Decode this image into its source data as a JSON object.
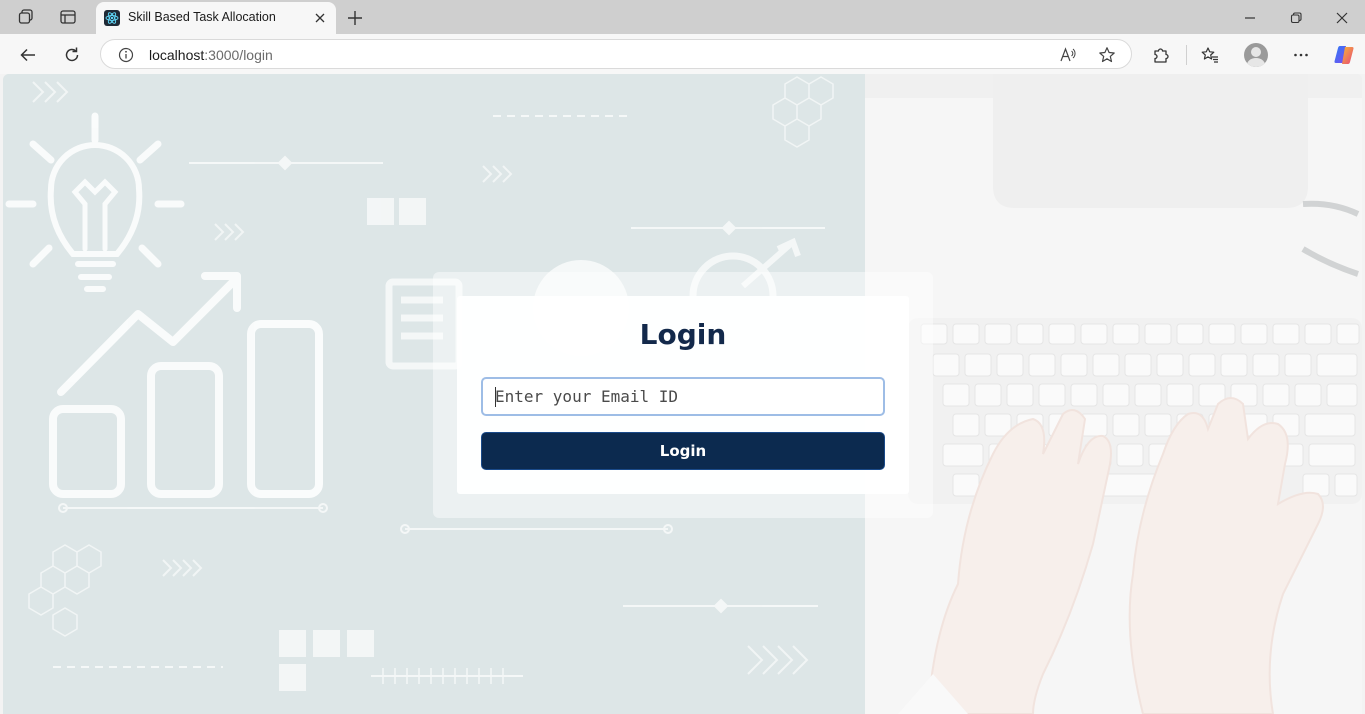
{
  "browser": {
    "tab_title": "Skill Based Task Allocation",
    "url_host": "localhost",
    "url_path": ":3000/login"
  },
  "icons": {
    "workspaces": "workspaces-icon",
    "tab_actions": "tab-actions-icon",
    "favicon": "react-icon",
    "close": "close-icon",
    "new_tab": "plus-icon",
    "minimize": "minimize-icon",
    "restore": "restore-icon",
    "window_close": "close-icon",
    "back": "back-arrow-icon",
    "refresh": "refresh-icon",
    "info": "info-icon",
    "read_aloud": "read-aloud-icon",
    "favorite": "star-icon",
    "extensions": "puzzle-icon",
    "favorites": "favorites-icon",
    "profile": "avatar-icon",
    "more": "more-icon",
    "copilot": "copilot-icon"
  },
  "login": {
    "title": "Login",
    "email_placeholder": "Enter your Email ID",
    "email_value": "",
    "button_label": "Login"
  },
  "colors": {
    "primary": "#0c2a4f",
    "title": "#13294b",
    "input_focus_border": "#9ebde6",
    "left_panel_bg": "#dde6e7"
  }
}
